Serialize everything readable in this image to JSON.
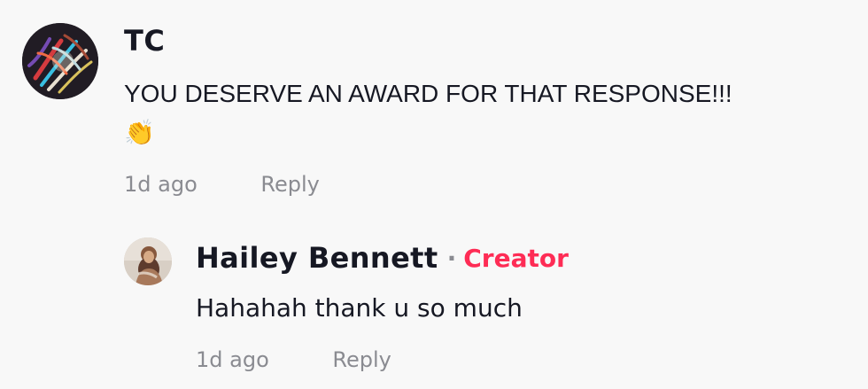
{
  "comment": {
    "username": "TC",
    "text": "YOU DESERVE AN AWARD FOR THAT RESPONSE!!!",
    "emoji": "👏",
    "avatar_icon": "abstract-artwork-avatar",
    "timestamp": "1d ago",
    "reply_label": "Reply"
  },
  "reply": {
    "username": "Hailey Bennett",
    "separator": "·",
    "badge": "Creator",
    "badge_color": "#fe2c55",
    "text": "Hahahah thank u so much",
    "avatar_icon": "profile-photo-avatar",
    "timestamp": "1d ago",
    "reply_label": "Reply"
  }
}
